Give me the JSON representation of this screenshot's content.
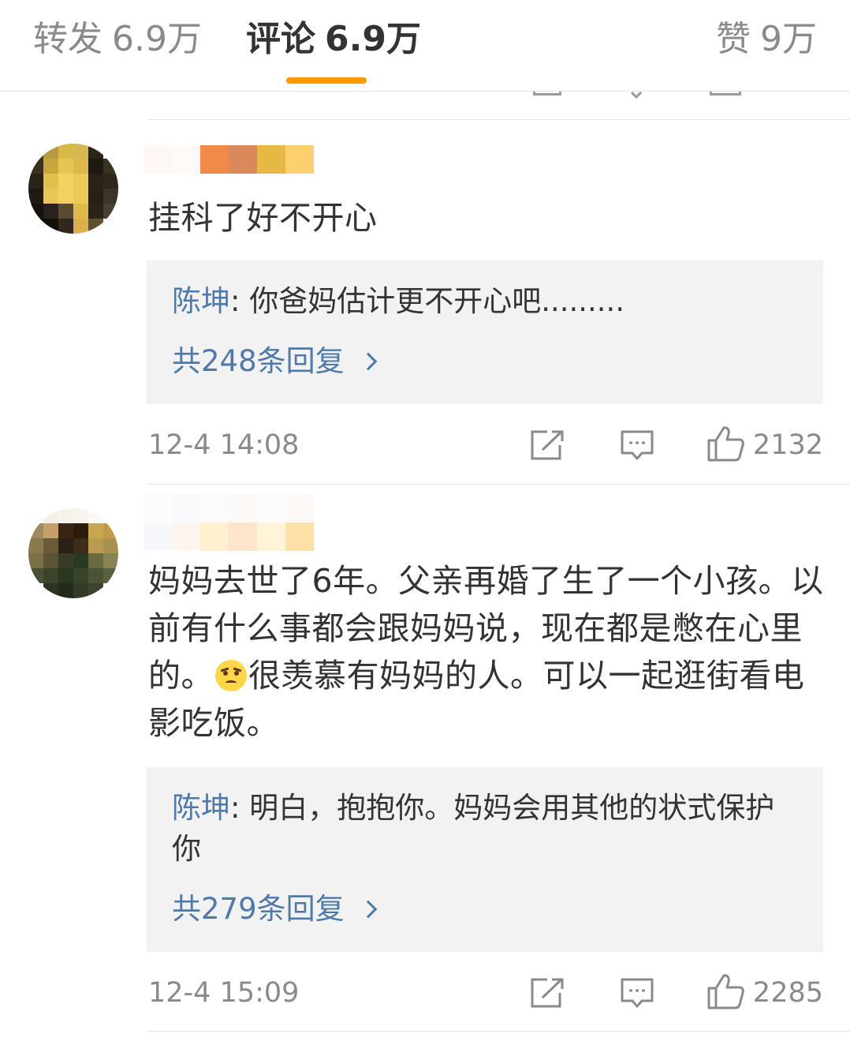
{
  "tabs": [
    {
      "label": "转发",
      "count": "6.9万"
    },
    {
      "label": "评论",
      "count": "6.9万",
      "active": true
    },
    {
      "label": "赞",
      "count": "9万"
    }
  ],
  "accent_color": "#ff9900",
  "link_color": "#4e7aaa",
  "comments": [
    {
      "text": "挂科了好不开心",
      "reply_author": "陈坤",
      "reply_text": ": 你爸妈估计更不开心吧.........",
      "reply_total": "共248条回复",
      "time": "12-4 14:08",
      "likes": "2132",
      "icons": [
        "share-icon",
        "comment-icon",
        "like-icon"
      ]
    },
    {
      "text_before_emoji": "妈妈去世了6年。父亲再婚了生了一个小孩。以前有什么事都会跟妈妈说，现在都是憋在心里的。",
      "emoji": "sad-face-emoji",
      "text_after_emoji": "很羡慕有妈妈的人。可以一起逛街看电影吃饭。",
      "reply_author": "陈坤",
      "reply_text": ": 明白，抱抱你。妈妈会用其他的状式保护你",
      "reply_total": "共279条回复",
      "time": "12-4 15:09",
      "likes": "2285",
      "icons": [
        "share-icon",
        "comment-icon",
        "like-icon"
      ]
    }
  ]
}
